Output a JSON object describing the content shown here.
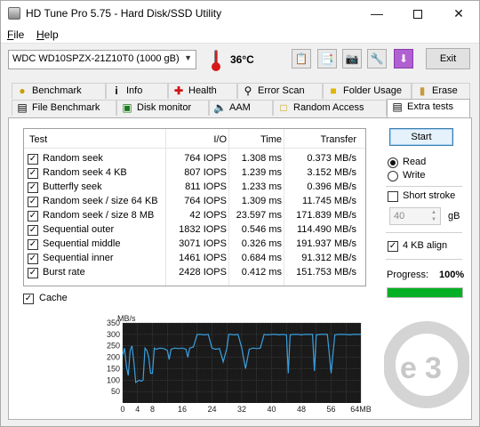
{
  "window": {
    "title": "HD Tune Pro 5.75 - Hard Disk/SSD Utility",
    "minimize": "—",
    "close": "✕"
  },
  "menu": {
    "file_u": "F",
    "file_rest": "ile",
    "help_u": "H",
    "help_rest": "elp"
  },
  "toolbar": {
    "drive": "WDC WD10SPZX-21Z10T0 (1000 gB)",
    "temperature": "36°C",
    "exit_label": "Exit"
  },
  "tabs": {
    "row1": [
      "Benchmark",
      "Info",
      "Health",
      "Error Scan",
      "Folder Usage",
      "Erase"
    ],
    "row2": [
      "File Benchmark",
      "Disk monitor",
      "AAM",
      "Random Access",
      "Extra tests"
    ],
    "active": "Extra tests"
  },
  "results": {
    "headers": {
      "test": "Test",
      "io": "I/O",
      "time": "Time",
      "transfer": "Transfer"
    },
    "rows": [
      {
        "test": "Random seek",
        "io": "764 IOPS",
        "time": "1.308 ms",
        "transfer": "0.373 MB/s",
        "checked": true
      },
      {
        "test": "Random seek 4 KB",
        "io": "807 IOPS",
        "time": "1.239 ms",
        "transfer": "3.152 MB/s",
        "checked": true
      },
      {
        "test": "Butterfly seek",
        "io": "811 IOPS",
        "time": "1.233 ms",
        "transfer": "0.396 MB/s",
        "checked": true
      },
      {
        "test": "Random seek / size 64 KB",
        "io": "764 IOPS",
        "time": "1.309 ms",
        "transfer": "11.745 MB/s",
        "checked": true
      },
      {
        "test": "Random seek / size 8 MB",
        "io": "42 IOPS",
        "time": "23.597 ms",
        "transfer": "171.839 MB/s",
        "checked": true
      },
      {
        "test": "Sequential outer",
        "io": "1832 IOPS",
        "time": "0.546 ms",
        "transfer": "114.490 MB/s",
        "checked": true
      },
      {
        "test": "Sequential middle",
        "io": "3071 IOPS",
        "time": "0.326 ms",
        "transfer": "191.937 MB/s",
        "checked": true
      },
      {
        "test": "Sequential inner",
        "io": "1461 IOPS",
        "time": "0.684 ms",
        "transfer": "91.312 MB/s",
        "checked": true
      },
      {
        "test": "Burst rate",
        "io": "2428 IOPS",
        "time": "0.412 ms",
        "transfer": "151.753 MB/s",
        "checked": true
      }
    ]
  },
  "controls": {
    "start_label": "Start",
    "read_label": "Read",
    "write_label": "Write",
    "mode": "read",
    "short_stroke_label": "Short stroke",
    "short_stroke_checked": false,
    "short_stroke_value": "40",
    "short_stroke_unit": "gB",
    "align_label": "4 KB align",
    "align_checked": true,
    "progress_label": "Progress:",
    "progress_value": "100%",
    "progress_fraction": 1.0,
    "cache_label": "Cache",
    "cache_checked": true
  },
  "colors": {
    "accent": "#3c7fb1",
    "progress_green": "#06b025",
    "chart_bg": "#1a1a1a",
    "chart_line": "#3aa0e0"
  },
  "chart_data": {
    "type": "line",
    "ylabel": "MB/s",
    "xlabel": "",
    "x_unit": "MB",
    "xlim": [
      0,
      64
    ],
    "ylim": [
      0,
      350
    ],
    "y_ticks": [
      50,
      100,
      150,
      200,
      250,
      300,
      350
    ],
    "x_ticks": [
      0,
      4,
      8,
      16,
      24,
      32,
      40,
      48,
      56,
      64
    ],
    "x_tick_labels": [
      "0",
      "4",
      "8",
      "16",
      "24",
      "32",
      "40",
      "48",
      "56",
      "64MB"
    ],
    "grid": true,
    "series": [
      {
        "x": [
          0,
          0.5,
          1,
          1.5,
          2,
          2.5,
          3,
          3.5,
          4,
          4.5,
          5,
          5.5,
          6,
          6.5,
          7,
          7.5,
          8,
          8.5,
          9,
          10,
          11,
          12,
          12.5,
          13,
          14,
          15,
          16,
          17,
          17.5,
          18,
          19,
          20,
          21,
          22,
          23,
          24,
          25,
          26,
          27,
          28,
          28.5,
          29,
          30,
          31,
          32,
          33,
          34,
          35,
          36,
          37,
          38,
          39,
          40,
          41,
          42,
          43,
          44,
          44.5,
          45,
          46,
          47,
          48,
          49,
          50,
          51,
          51.5,
          52,
          53,
          54,
          55,
          56,
          57,
          58,
          59,
          60,
          61,
          62,
          63,
          64
        ],
        "y": [
          210,
          240,
          160,
          120,
          230,
          250,
          180,
          90,
          95,
          100,
          95,
          100,
          240,
          230,
          200,
          130,
          130,
          240,
          235,
          240,
          238,
          230,
          190,
          235,
          240,
          238,
          240,
          235,
          200,
          240,
          245,
          300,
          300,
          298,
          300,
          240,
          235,
          238,
          180,
          240,
          300,
          300,
          298,
          300,
          240,
          150,
          235,
          240,
          238,
          240,
          300,
          298,
          300,
          300,
          298,
          300,
          298,
          130,
          298,
          300,
          300,
          298,
          300,
          300,
          300,
          140,
          298,
          300,
          300,
          300,
          130,
          298,
          300,
          300,
          300,
          298,
          300,
          300,
          300
        ]
      }
    ]
  }
}
